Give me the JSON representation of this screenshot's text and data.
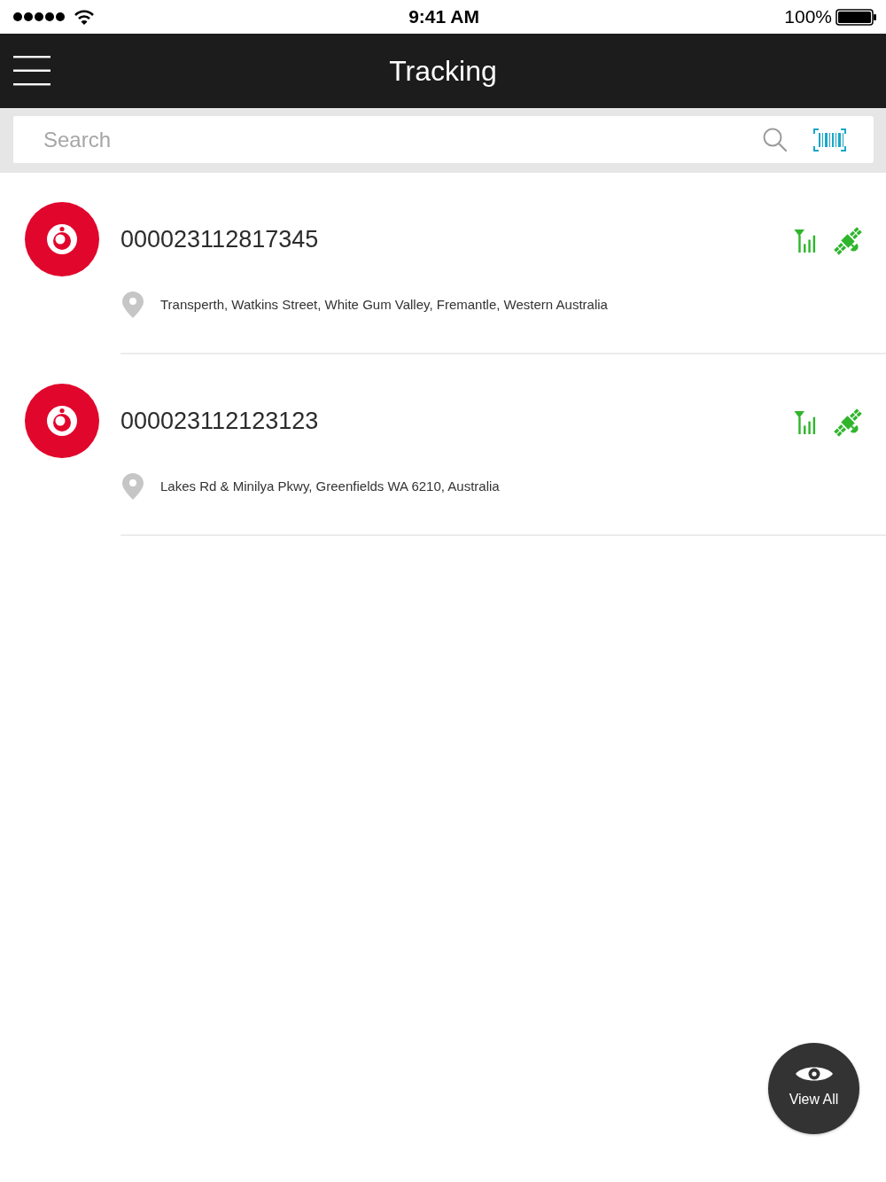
{
  "status_bar": {
    "time": "9:41 AM",
    "battery": "100%"
  },
  "nav_bar": {
    "title": "Tracking"
  },
  "search": {
    "placeholder": "Search"
  },
  "devices": [
    {
      "id": "000023112817345",
      "address": "Transperth, Watkins Street, White Gum Valley, Fremantle, Western Australia"
    },
    {
      "id": "000023112123123",
      "address": "Lakes Rd & Minilya Pkwy, Greenfields WA 6210, Australia"
    }
  ],
  "fab": {
    "label": "View All"
  }
}
